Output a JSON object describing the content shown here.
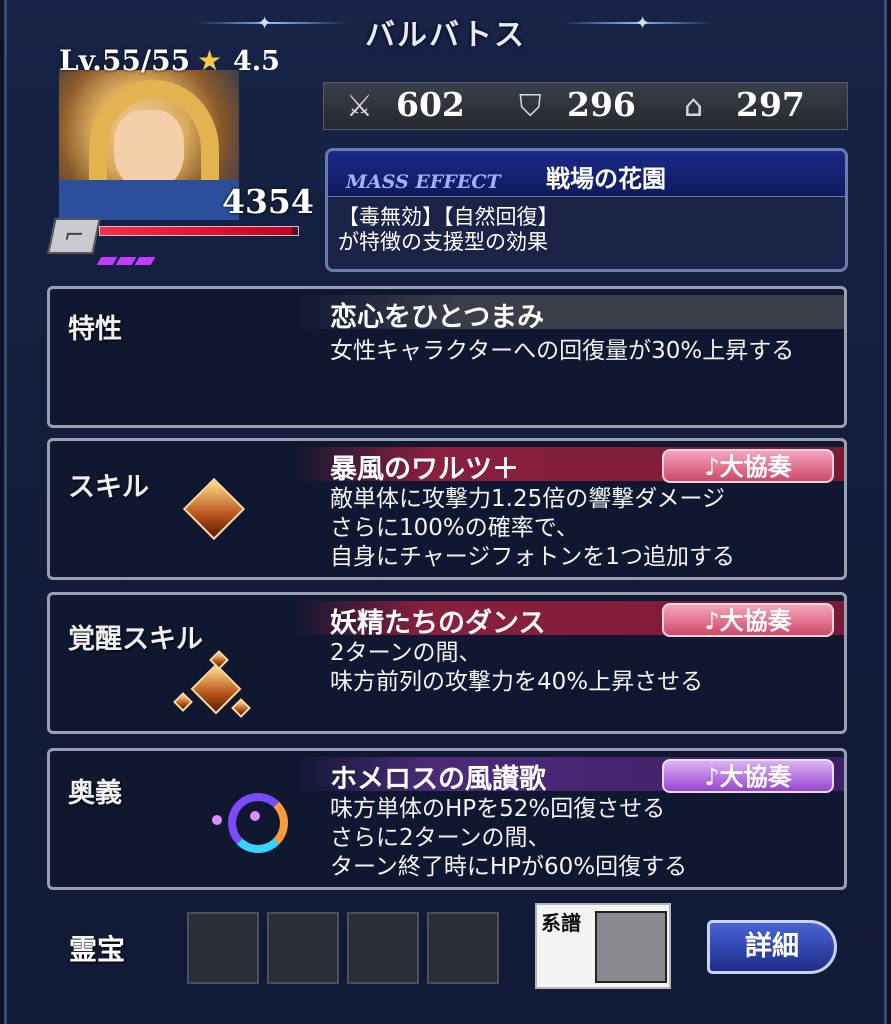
{
  "title": "バルバトス",
  "level": "Lv.55/55",
  "rating": "4.5",
  "hp": "4354",
  "hp_fraction": 0.97,
  "stats": {
    "attack": "602",
    "defense": "296",
    "speed": "297"
  },
  "mass_effect": {
    "label": "MASS EFFECT",
    "name": "戦場の花園",
    "desc_line1": "【毒無効】【自然回復】",
    "desc_line2": "が特徴の支援型の効果"
  },
  "trait": {
    "label": "特性",
    "name": "恋心をひとつまみ",
    "desc_line1": "女性キャラクターへの回復量が30%上昇する"
  },
  "skill": {
    "label": "スキル",
    "name": "暴風のワルツ＋",
    "badge": "♪大協奏",
    "desc_line1": "敵単体に攻撃力1.25倍の響撃ダメージ",
    "desc_line2": "さらに100%の確率で、",
    "desc_line3": "自身にチャージフォトンを1つ追加する"
  },
  "awaken": {
    "label": "覚醒スキル",
    "name": "妖精たちのダンス",
    "badge": "♪大協奏",
    "desc_line1": "2ターンの間、",
    "desc_line2": "味方前列の攻撃力を40%上昇させる"
  },
  "ougi": {
    "label": "奥義",
    "name": "ホメロスの風讃歌",
    "badge": "♪大協奏",
    "desc_line1": "味方単体のHPを52%回復させる",
    "desc_line2": "さらに2ターンの間、",
    "desc_line3": "ターン終了時にHPが60%回復する"
  },
  "reiho": {
    "label": "霊宝"
  },
  "keifu": {
    "label": "系譜"
  },
  "detail_button": "詳細"
}
